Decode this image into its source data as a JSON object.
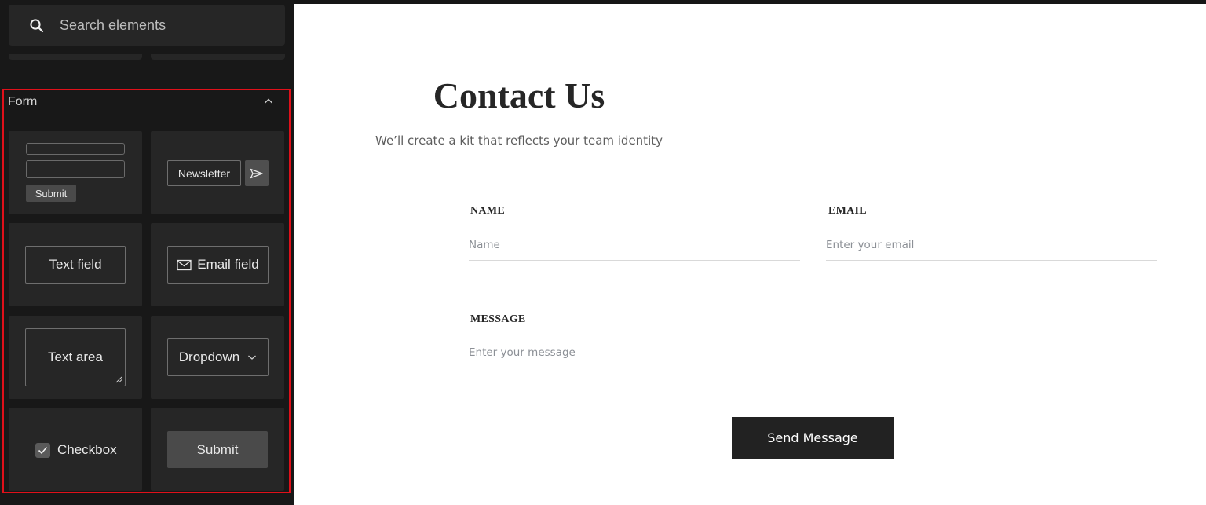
{
  "sidebar": {
    "search": {
      "placeholder": "Search elements",
      "value": ""
    },
    "section": {
      "title": "Form",
      "expanded": true,
      "highlight_color": "#e0101a"
    },
    "tiles": {
      "form_mini_submit": "Submit",
      "newsletter": "Newsletter",
      "text_field": "Text field",
      "email_field": "Email field",
      "text_area": "Text area",
      "dropdown": "Dropdown",
      "checkbox": "Checkbox",
      "submit": "Submit"
    }
  },
  "canvas": {
    "title": "Contact Us",
    "subtitle": "We’ll create a kit that reflects your team identity",
    "fields": {
      "name": {
        "label": "NAME",
        "placeholder": "Name",
        "value": ""
      },
      "email": {
        "label": "EMAIL",
        "placeholder": "Enter your email",
        "value": ""
      },
      "message": {
        "label": "MESSAGE",
        "placeholder": "Enter your message",
        "value": ""
      }
    },
    "send_button": "Send Message"
  },
  "colors": {
    "sidebar_bg": "#181818",
    "tile_bg": "#262626",
    "canvas_bg": "#ffffff",
    "button_dark": "#222222"
  }
}
